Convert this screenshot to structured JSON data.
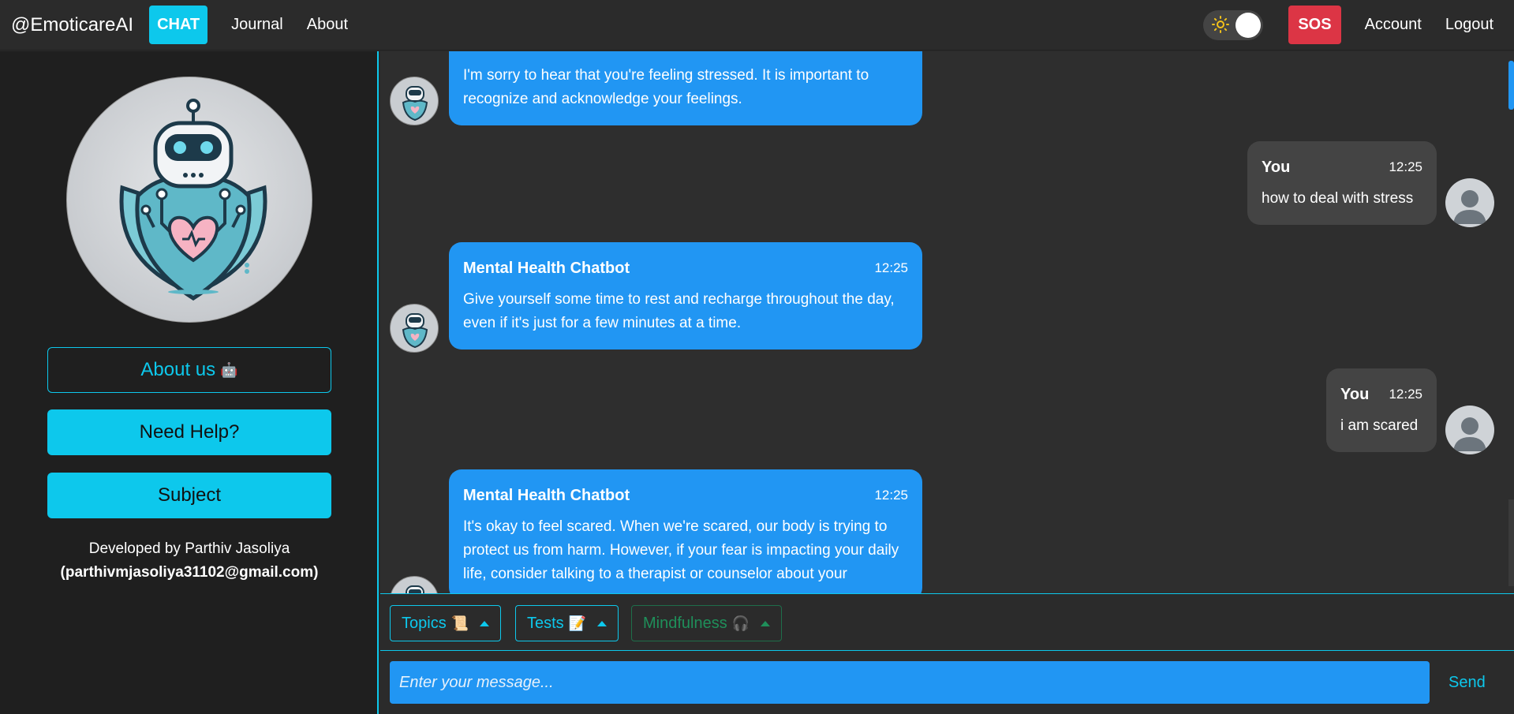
{
  "nav": {
    "brand": "@EmoticareAI",
    "chat": "CHAT",
    "journal": "Journal",
    "about": "About",
    "sos": "SOS",
    "account": "Account",
    "logout": "Logout",
    "theme_icon": "sun-icon"
  },
  "sidebar": {
    "about_us": "About us",
    "about_us_emoji": "🤖",
    "need_help": "Need Help?",
    "subject": "Subject",
    "developer": "Developed by Parthiv Jasoliya",
    "email": "(parthivmjasoliya31102@gmail.com)"
  },
  "messages": [
    {
      "sender": "",
      "time": "",
      "text": "I'm sorry to hear that you're feeling stressed. It is important to recognize and acknowledge your feelings."
    },
    {
      "sender": "You",
      "time": "12:25",
      "text": "how to deal with stress"
    },
    {
      "sender": "Mental Health Chatbot",
      "time": "12:25",
      "text": "Give yourself some time to rest and recharge throughout the day, even if it's just for a few minutes at a time."
    },
    {
      "sender": "You",
      "time": "12:25",
      "text": "i am scared"
    },
    {
      "sender": "Mental Health Chatbot",
      "time": "12:25",
      "text": "It's okay to feel scared. When we're scared, our body is trying to protect us from harm. However, if your fear is impacting your daily life, consider talking to a therapist or counselor about your"
    }
  ],
  "tools": {
    "topics": "Topics",
    "topics_emoji": "📜",
    "tests": "Tests",
    "tests_emoji": "📝",
    "mindfulness": "Mindfulness",
    "mindfulness_emoji": "🎧"
  },
  "composer": {
    "placeholder": "Enter your message...",
    "send": "Send"
  },
  "colors": {
    "accent": "#0dc8ec",
    "bot_bubble": "#2196f3",
    "user_bubble": "#444444",
    "sos": "#dc3545"
  }
}
